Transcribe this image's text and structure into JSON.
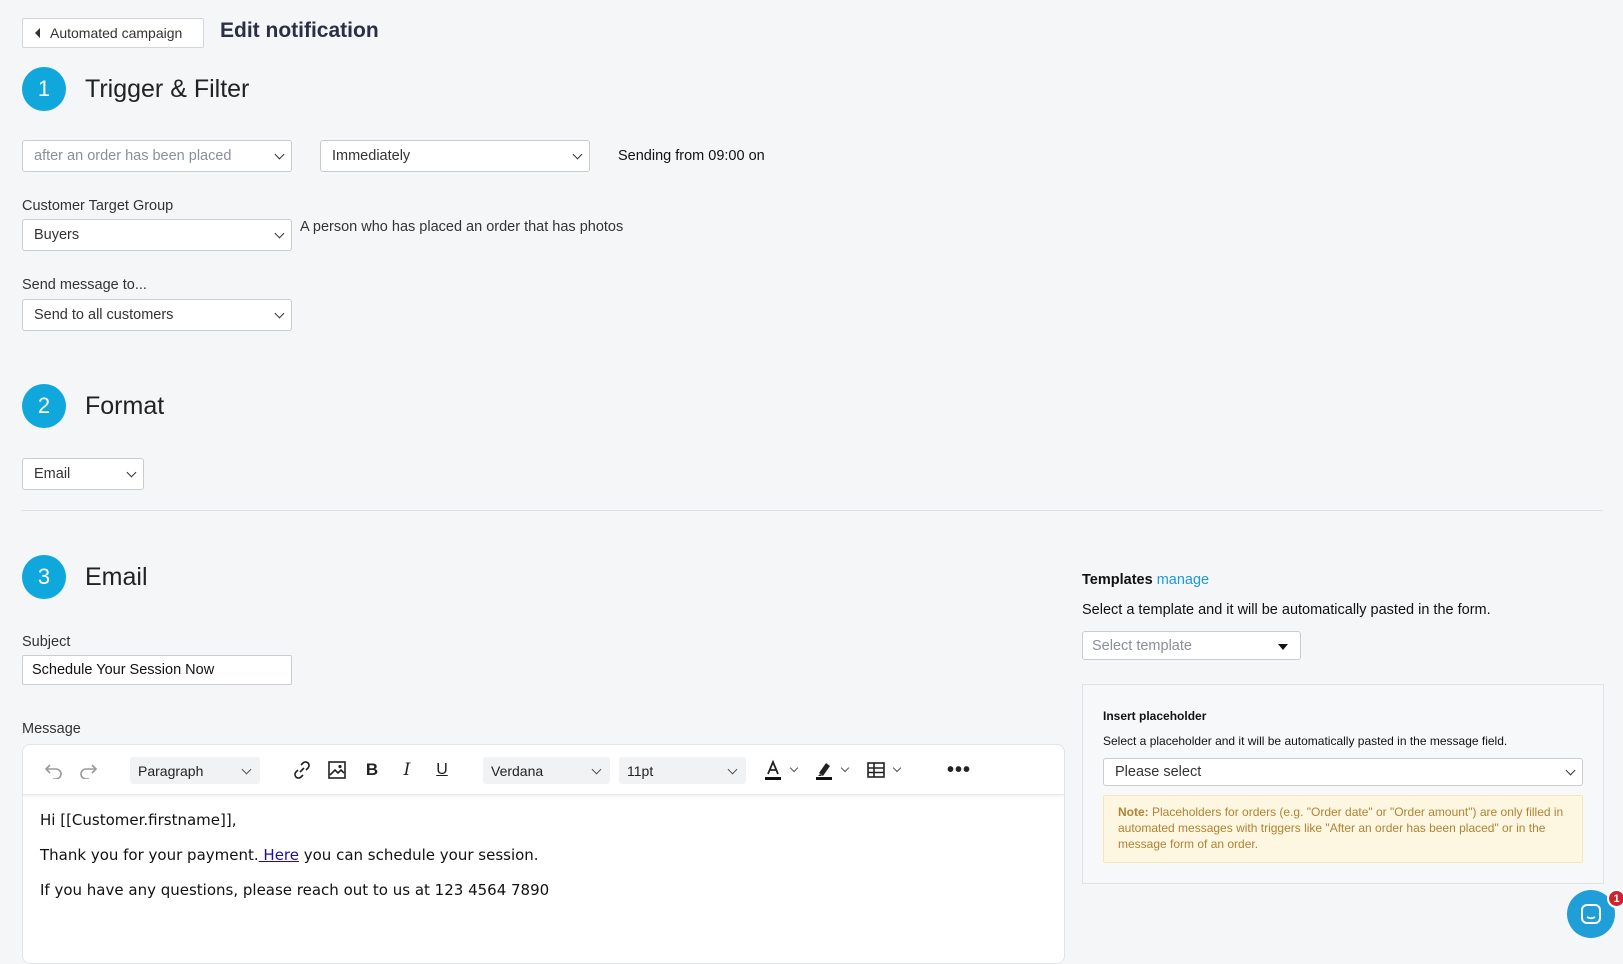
{
  "header": {
    "back_label": "Automated campaign",
    "title": "Edit notification"
  },
  "step1": {
    "number": "1",
    "title": "Trigger & Filter",
    "trigger_select": "after an order has been placed",
    "timing_select": "Immediately",
    "sending_text": "Sending from 09:00 on",
    "target_group_label": "Customer Target Group",
    "target_group_select": "Buyers",
    "target_group_desc": "A person who has placed an order that has photos",
    "send_to_label": "Send message to...",
    "send_to_select": "Send to all customers"
  },
  "step2": {
    "number": "2",
    "title": "Format",
    "format_select": "Email"
  },
  "step3": {
    "number": "3",
    "title": "Email",
    "subject_label": "Subject",
    "subject_value": "Schedule Your Session Now",
    "message_label": "Message"
  },
  "editor": {
    "block_format": "Paragraph",
    "font_family": "Verdana",
    "font_size": "11pt",
    "line1": "Hi [[Customer.firstname]],",
    "line2_before": "Thank you for your payment.",
    "line2_link": " Here",
    "line2_after": " you can schedule your session.",
    "line3": "If you have any questions, please reach out to us at 123 4564 7890"
  },
  "templates": {
    "title": "Templates",
    "manage_link": "manage",
    "description": "Select a template and it will be automatically pasted in the form.",
    "select_placeholder": "Select template"
  },
  "placeholder_panel": {
    "title": "Insert placeholder",
    "description": "Select a placeholder and it will be automatically pasted in the message field.",
    "select_value": "Please select",
    "note_label": "Note:",
    "note_text": " Placeholders for orders (e.g. \"Order date\" or \"Order amount\") are only filled in automated messages with triggers like \"After an order has been placed\" or in the message form of an order."
  },
  "chat": {
    "badge_count": "1"
  },
  "colors": {
    "accent": "#0fa7dc",
    "link": "#1e9ad6",
    "note_bg": "#fdf6e0",
    "note_text": "#b08335",
    "badge": "#d4202c"
  }
}
